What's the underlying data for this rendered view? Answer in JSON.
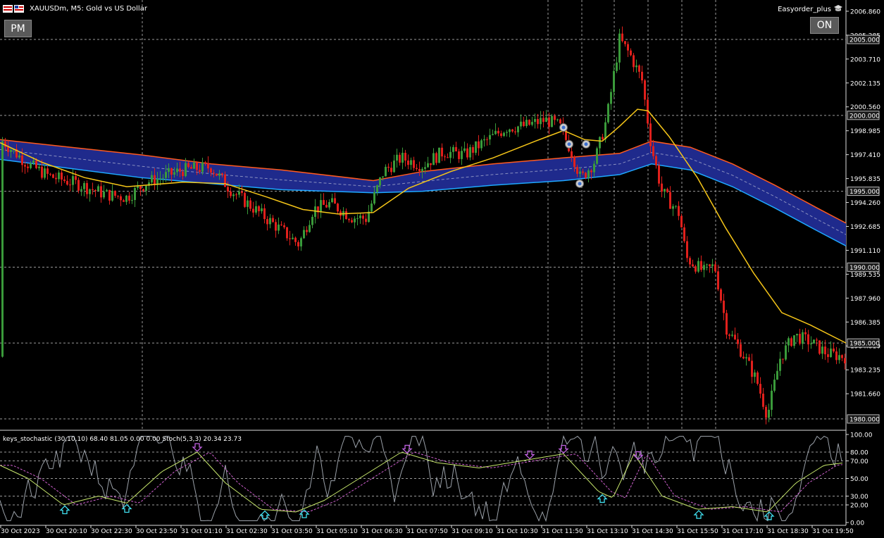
{
  "window": {
    "symbol_title": "XAUUSDm, M5:  Gold vs US Dollar",
    "ea_name": "Easyorder_plus",
    "pm_label": "PM",
    "on_label": "ON",
    "icons": {
      "symbol": "chart-flag-icon",
      "ea": "graduation-cap-icon"
    }
  },
  "colors": {
    "background": "#000000",
    "bull_candle": "#3a9a3a",
    "bear_candle": "#e0201c",
    "ema_yellow": "#f5c518",
    "band_upper": "#ff5a1f",
    "band_lower": "#1ea8ff",
    "band_fill": "#1f2a8c",
    "stoch_fast": "#9aa0a8",
    "stoch_k": "#c8e86c",
    "stoch_d": "#d060d0",
    "arrow_up": "#40e0f0",
    "arrow_down": "#c060e0"
  },
  "main_chart": {
    "y_axis_labels": [
      "2006.860",
      "2005.285",
      "2003.710",
      "2002.135",
      "2000.560",
      "1998.985",
      "1997.410",
      "1995.835",
      "1994.260",
      "1992.685",
      "1991.110",
      "1989.535",
      "1987.960",
      "1986.385",
      "1984.810",
      "1983.235",
      "1981.660"
    ],
    "level_labels": [
      "2005.000",
      "2000.000",
      "1995.000",
      "1990.000",
      "1985.000",
      "1980.000"
    ]
  },
  "indicator": {
    "header": "keys_stochastic (30,10,10) 68.40 81.05 0.00 0.00 Stoch(5,3,3) 20.34 23.73",
    "y_axis_labels": [
      "100.00",
      "80.00",
      "70.00",
      "50.00",
      "30.00",
      "20.00",
      "0.00"
    ]
  },
  "time_axis": {
    "labels": [
      "30 Oct 2023",
      "30 Oct 20:10",
      "30 Oct 22:30",
      "30 Oct 23:50",
      "31 Oct 01:10",
      "31 Oct 02:30",
      "31 Oct 03:50",
      "31 Oct 05:10",
      "31 Oct 06:30",
      "31 Oct 07:50",
      "31 Oct 09:10",
      "31 Oct 10:30",
      "31 Oct 11:50",
      "31 Oct 13:10",
      "31 Oct 14:30",
      "31 Oct 15:50",
      "31 Oct 17:10",
      "31 Oct 18:30",
      "31 Oct 19:50"
    ]
  }
}
